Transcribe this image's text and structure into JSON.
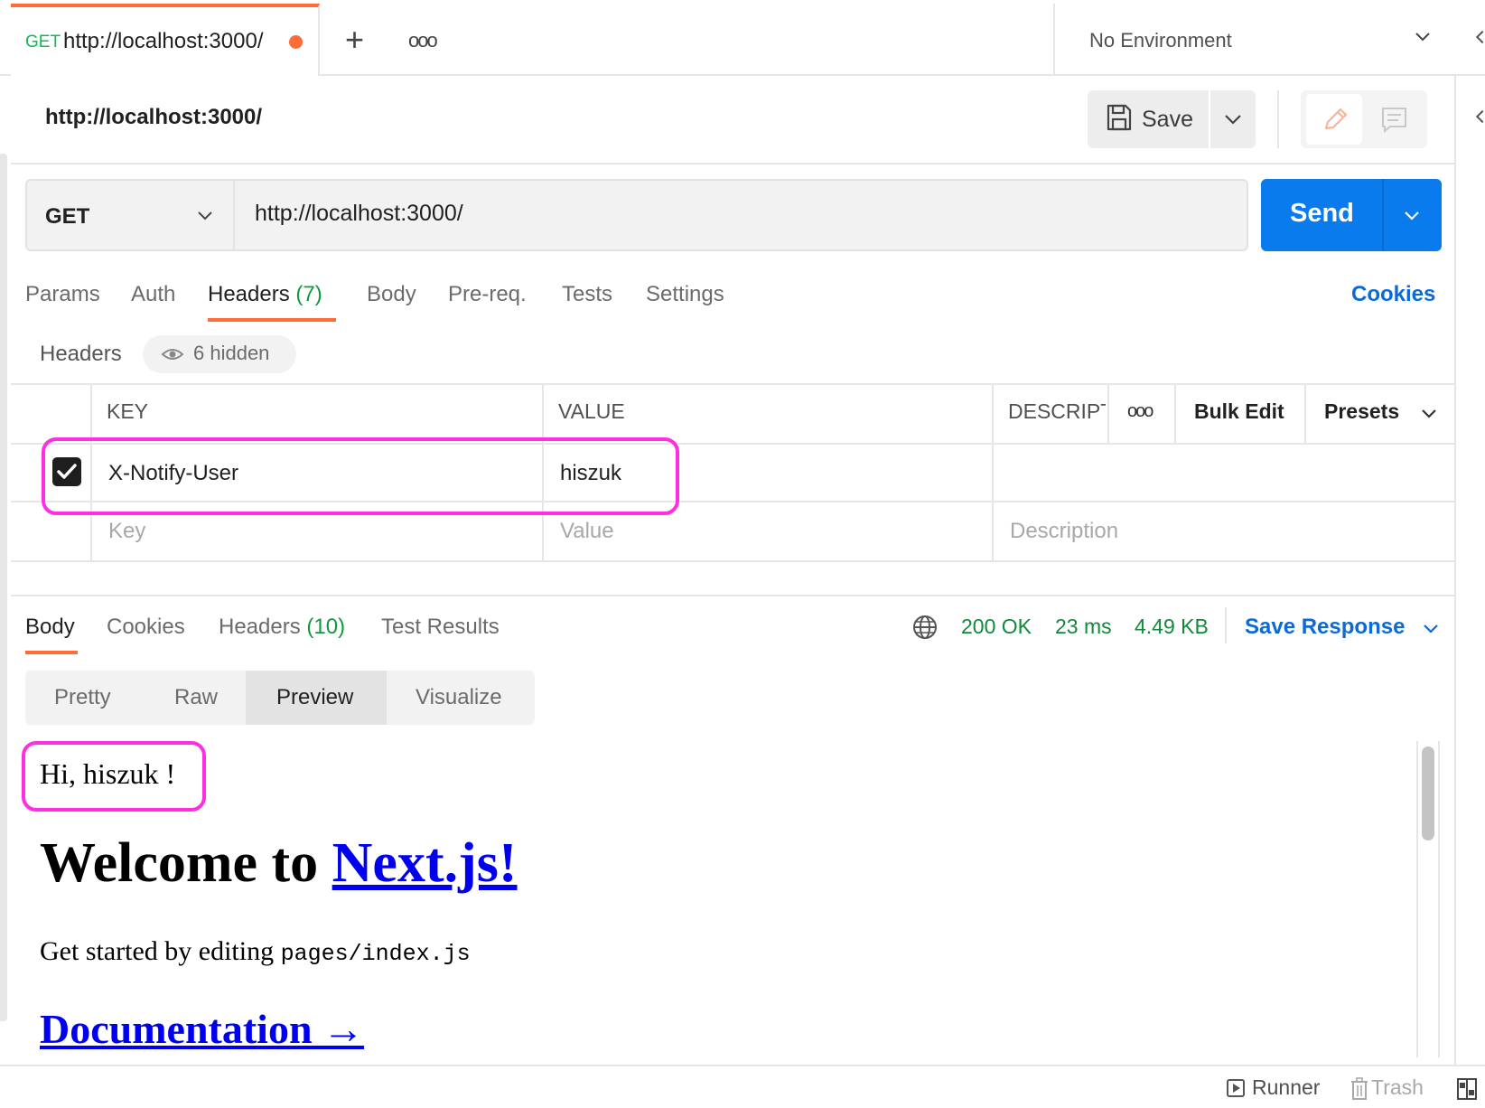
{
  "tab": {
    "method": "GET",
    "url": "http://localhost:3000/"
  },
  "environment": {
    "label": "No Environment"
  },
  "request": {
    "title": "http://localhost:3000/",
    "save_label": "Save",
    "method": "GET",
    "url": "http://localhost:3000/",
    "send_label": "Send"
  },
  "request_tabs": {
    "params": "Params",
    "auth": "Auth",
    "headers": "Headers",
    "headers_count": "(7)",
    "body": "Body",
    "prereq": "Pre-req.",
    "tests": "Tests",
    "settings": "Settings",
    "cookies": "Cookies"
  },
  "headers_section": {
    "title": "Headers",
    "hidden": "6 hidden"
  },
  "table": {
    "col_key": "KEY",
    "col_value": "VALUE",
    "col_desc": "DESCRIPT",
    "bulk_edit": "Bulk Edit",
    "presets": "Presets",
    "rows": [
      {
        "key": "X-Notify-User",
        "value": "hiszuk",
        "checked": true
      }
    ],
    "placeholder": {
      "key": "Key",
      "value": "Value",
      "description": "Description"
    }
  },
  "response_tabs": {
    "body": "Body",
    "cookies": "Cookies",
    "headers": "Headers",
    "headers_count": "(10)",
    "test_results": "Test Results"
  },
  "status": {
    "code": "200 OK",
    "time": "23 ms",
    "size": "4.49 KB",
    "save_response": "Save Response"
  },
  "view_modes": {
    "pretty": "Pretty",
    "raw": "Raw",
    "preview": "Preview",
    "visualize": "Visualize",
    "selected": "Preview"
  },
  "preview": {
    "greeting": "Hi, hiszuk !",
    "welcome_prefix": "Welcome to ",
    "welcome_link": "Next.js!",
    "started_prefix": "Get started by editing ",
    "started_code": "pages/index.js",
    "docs_link": "Documentation →"
  },
  "footer": {
    "runner": "Runner",
    "trash": "Trash"
  },
  "colors": {
    "accent_orange": "#ff6c37",
    "send_blue": "#097bed",
    "link_blue": "#0b6ad8",
    "status_green": "#0f8a3a",
    "highlight_magenta": "#ff2ee0"
  },
  "icons": [
    "plus-icon",
    "more-icon",
    "chevron-down-icon",
    "save-icon",
    "pencil-icon",
    "comment-icon",
    "eye-icon",
    "checkbox-checked-icon",
    "globe-icon",
    "runner-icon",
    "trash-icon",
    "layout-icon"
  ]
}
